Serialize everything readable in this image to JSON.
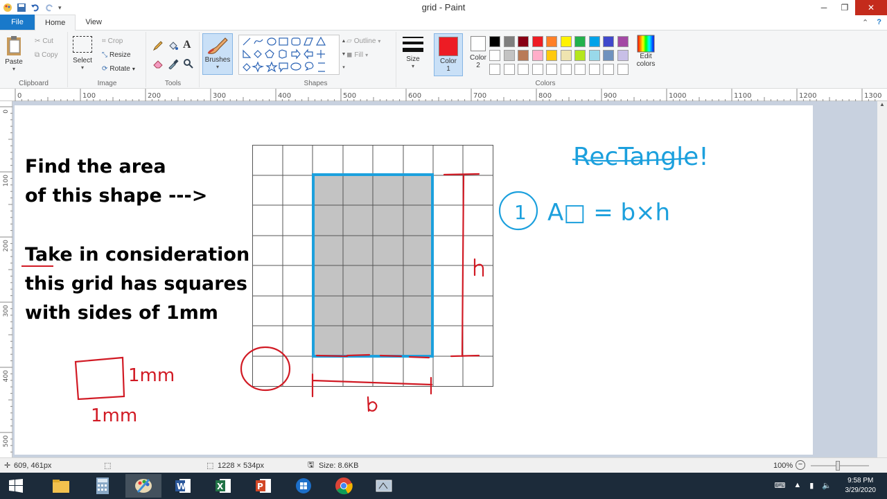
{
  "window": {
    "title": "grid - Paint"
  },
  "tabs": {
    "file": "File",
    "home": "Home",
    "view": "View"
  },
  "clipboard": {
    "paste": "Paste",
    "cut": "Cut",
    "copy": "Copy",
    "label": "Clipboard"
  },
  "image": {
    "select": "Select",
    "crop": "Crop",
    "resize": "Resize",
    "rotate": "Rotate",
    "label": "Image"
  },
  "tools": {
    "label": "Tools",
    "text_tool": "A"
  },
  "brushes": {
    "label": "Brushes"
  },
  "shapes": {
    "outline": "Outline",
    "fill": "Fill",
    "label": "Shapes"
  },
  "size": {
    "label": "Size"
  },
  "colors": {
    "color1_label": "Color\n1",
    "color2_label": "Color\n2",
    "color1": "#ed1c24",
    "color2": "#ffffff",
    "edit": "Edit colors",
    "label": "Colors",
    "palette_row1": [
      "#000000",
      "#7f7f7f",
      "#880015",
      "#ed1c24",
      "#ff7f27",
      "#fff200",
      "#22b14c",
      "#00a2e8",
      "#3f48cc",
      "#a349a4"
    ],
    "palette_row2": [
      "#ffffff",
      "#c3c3c3",
      "#b97a57",
      "#ffaec9",
      "#ffc90e",
      "#efe4b0",
      "#b5e61d",
      "#99d9ea",
      "#7092be",
      "#c8bfe7"
    ]
  },
  "ruler": {
    "h_ticks": [
      "0",
      "100",
      "200",
      "300",
      "400",
      "500",
      "600",
      "700",
      "800",
      "900",
      "1000",
      "1100",
      "1200",
      "1300"
    ],
    "v_ticks": [
      "0",
      "100",
      "200",
      "300",
      "400",
      "500"
    ]
  },
  "canvas": {
    "prompt_lines": [
      "Find the area",
      "of this shape --->"
    ],
    "note_lines": [
      "Take in consideration",
      "this grid has squares",
      "with sides of 1mm"
    ],
    "unit_top": "1mm",
    "unit_bottom": "1mm",
    "label_h": "h",
    "label_b": "b",
    "heading": "RecTangle!",
    "step": "1",
    "formula": "A□ = b×h"
  },
  "status": {
    "cursor_pos": "609, 461px",
    "dimensions": "1228 × 534px",
    "size": "Size: 8.6KB",
    "zoom": "100%"
  },
  "taskbar": {
    "time": "9:58 PM",
    "date": "3/29/2020"
  }
}
